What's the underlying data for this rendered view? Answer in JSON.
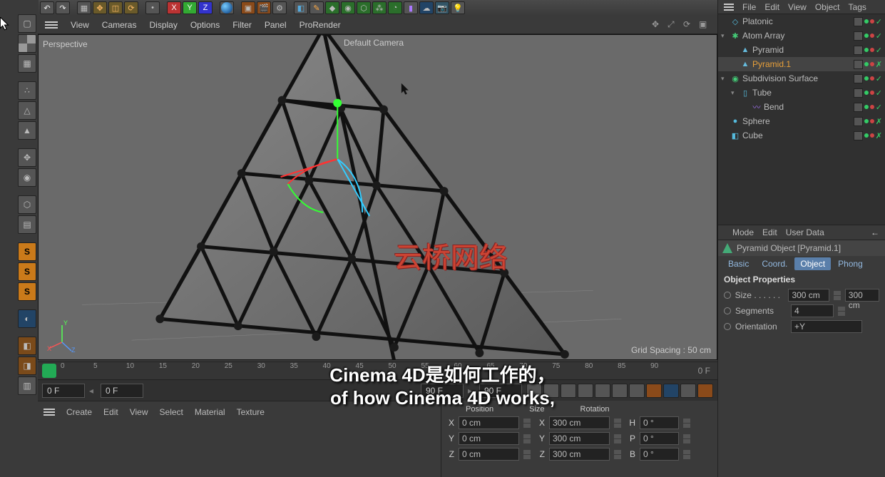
{
  "viewport_menu": {
    "view": "View",
    "cameras": "Cameras",
    "display": "Display",
    "options": "Options",
    "filter": "Filter",
    "panel": "Panel",
    "prorender": "ProRender"
  },
  "viewport": {
    "perspective": "Perspective",
    "default_camera": "Default Camera ",
    "grid_spacing": "Grid Spacing : 50 cm"
  },
  "obj_menu": {
    "file": "File",
    "edit": "Edit",
    "view": "View",
    "object": "Object",
    "tags": "Tags"
  },
  "tree": [
    {
      "name": "Platonic",
      "indent": 0,
      "icon": "platonic",
      "sel": false,
      "check": true
    },
    {
      "name": "Atom Array",
      "indent": 0,
      "icon": "atom",
      "sel": false,
      "check": true,
      "exp": "▾"
    },
    {
      "name": "Pyramid",
      "indent": 1,
      "icon": "pyramid",
      "sel": false,
      "check": true
    },
    {
      "name": "Pyramid.1",
      "indent": 1,
      "icon": "pyramid",
      "sel": true,
      "check": false
    },
    {
      "name": "Subdivision Surface",
      "indent": 0,
      "icon": "subdiv",
      "sel": false,
      "check": true,
      "exp": "▾"
    },
    {
      "name": "Tube",
      "indent": 1,
      "icon": "tube",
      "sel": false,
      "check": true,
      "exp": "▾"
    },
    {
      "name": "Bend",
      "indent": 2,
      "icon": "bend",
      "sel": false,
      "check": true
    },
    {
      "name": "Sphere",
      "indent": 0,
      "icon": "sphere",
      "sel": false,
      "check": false
    },
    {
      "name": "Cube",
      "indent": 0,
      "icon": "cube",
      "sel": false,
      "check": false
    }
  ],
  "attr_menu": {
    "mode": "Mode",
    "edit": "Edit",
    "user_data": "User Data"
  },
  "attr_title": "Pyramid Object [Pyramid.1]",
  "attr_tabs": {
    "basic": "Basic",
    "coord": "Coord.",
    "object": "Object",
    "phong": "Phong"
  },
  "attr_section": "Object Properties",
  "attrs": {
    "size_label": "Size . . . . . .",
    "size_val": "300 cm",
    "size_val2": "300 cm",
    "segments_label": "Segments",
    "segments_val": "4",
    "orientation_label": "Orientation",
    "orientation_val": "+Y"
  },
  "timeline": {
    "ticks": [
      "0",
      "5",
      "10",
      "15",
      "20",
      "25",
      "30",
      "35",
      "40",
      "45",
      "50",
      "55",
      "60",
      "65",
      "70",
      "75",
      "80",
      "85",
      "90"
    ],
    "end": "0 F"
  },
  "timebar": {
    "a": "0 F",
    "b": "0 F",
    "c": "90 F",
    "d": "90 F"
  },
  "material_menu": {
    "create": "Create",
    "edit": "Edit",
    "view": "View",
    "select": "Select",
    "material": "Material",
    "texture": "Texture"
  },
  "coords": {
    "hdr": {
      "pos": "Position",
      "size": "Size",
      "rot": "Rotation"
    },
    "rows": [
      {
        "l": "X",
        "p": "0 cm",
        "s": "300 cm",
        "r": "H",
        "rv": "0 °"
      },
      {
        "l": "Y",
        "p": "0 cm",
        "s": "300 cm",
        "r": "P",
        "rv": "0 °"
      },
      {
        "l": "Z",
        "p": "0 cm",
        "s": "300 cm",
        "r": "B",
        "rv": "0 °"
      }
    ]
  },
  "subtitles": {
    "cn": "Cinema 4D是如何工作的，",
    "en": "of how Cinema 4D works,"
  },
  "watermark": "云桥网络"
}
